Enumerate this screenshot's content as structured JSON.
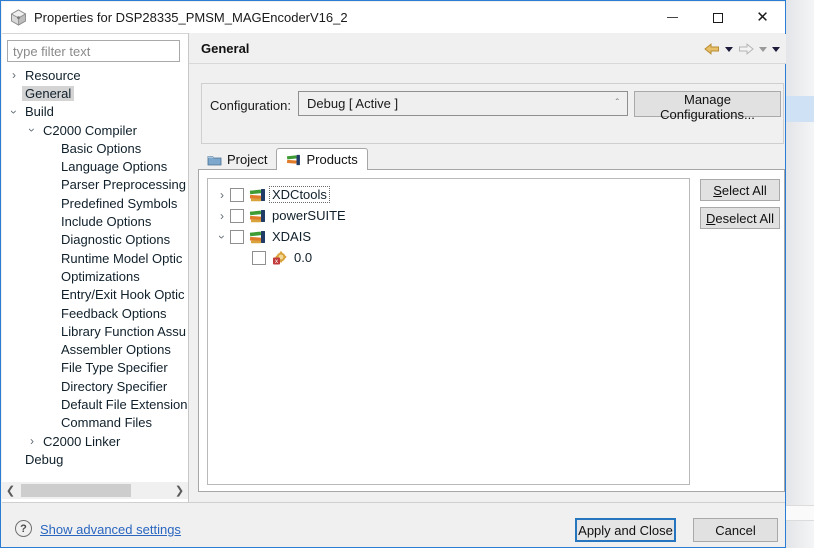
{
  "window": {
    "title": "Properties for DSP28335_PMSM_MAGEncoderV16_2",
    "controls": {
      "minimize": "minimize",
      "maximize": "maximize",
      "close": "close"
    }
  },
  "colors": {
    "accent_border": "#2b7cd3",
    "link": "#2a66c0",
    "selection_bg": "#d4d4d4",
    "background_band_blue": "#cfe2f5"
  },
  "sidebar": {
    "filter_placeholder": "type filter text",
    "items": [
      {
        "label": "Resource",
        "level": 0,
        "expander": "collapsed",
        "selected": false
      },
      {
        "label": "General",
        "level": 0,
        "expander": "none",
        "selected": true
      },
      {
        "label": "Build",
        "level": 0,
        "expander": "expanded",
        "selected": false
      },
      {
        "label": "C2000 Compiler",
        "level": 1,
        "expander": "expanded",
        "selected": false
      },
      {
        "label": "Basic Options",
        "level": 2,
        "expander": "none",
        "selected": false
      },
      {
        "label": "Language Options",
        "level": 2,
        "expander": "none",
        "selected": false
      },
      {
        "label": "Parser Preprocessing",
        "level": 2,
        "expander": "none",
        "selected": false
      },
      {
        "label": "Predefined Symbols",
        "level": 2,
        "expander": "none",
        "selected": false
      },
      {
        "label": "Include Options",
        "level": 2,
        "expander": "none",
        "selected": false
      },
      {
        "label": "Diagnostic Options",
        "level": 2,
        "expander": "none",
        "selected": false
      },
      {
        "label": "Runtime Model Optic",
        "level": 2,
        "expander": "none",
        "selected": false
      },
      {
        "label": "Optimizations",
        "level": 2,
        "expander": "none",
        "selected": false
      },
      {
        "label": "Entry/Exit Hook Optic",
        "level": 2,
        "expander": "none",
        "selected": false
      },
      {
        "label": "Feedback Options",
        "level": 2,
        "expander": "none",
        "selected": false
      },
      {
        "label": "Library Function Assu",
        "level": 2,
        "expander": "none",
        "selected": false
      },
      {
        "label": "Assembler Options",
        "level": 2,
        "expander": "none",
        "selected": false
      },
      {
        "label": "File Type Specifier",
        "level": 2,
        "expander": "none",
        "selected": false
      },
      {
        "label": "Directory Specifier",
        "level": 2,
        "expander": "none",
        "selected": false
      },
      {
        "label": "Default File Extension",
        "level": 2,
        "expander": "none",
        "selected": false
      },
      {
        "label": "Command Files",
        "level": 2,
        "expander": "none",
        "selected": false
      },
      {
        "label": "C2000 Linker",
        "level": 1,
        "expander": "collapsed",
        "selected": false
      },
      {
        "label": "Debug",
        "level": 0,
        "expander": "none",
        "selected": false
      }
    ]
  },
  "header": {
    "title": "General"
  },
  "config": {
    "label": "Configuration:",
    "value": "Debug  [ Active ]",
    "manage_button": "Manage Configurations..."
  },
  "tabs": [
    {
      "label": "Project",
      "icon": "folder-icon",
      "active": false
    },
    {
      "label": "Products",
      "icon": "products-icon",
      "active": true
    }
  ],
  "products_tree": {
    "items": [
      {
        "label": "XDCtools",
        "level": 0,
        "expander": "collapsed",
        "checked": false,
        "focused": true,
        "icon": "package-stack-icon"
      },
      {
        "label": "powerSUITE",
        "level": 0,
        "expander": "collapsed",
        "checked": false,
        "focused": false,
        "icon": "package-stack-icon"
      },
      {
        "label": "XDAIS",
        "level": 0,
        "expander": "expanded",
        "checked": false,
        "focused": false,
        "icon": "package-stack-icon"
      },
      {
        "label": "0.0",
        "level": 1,
        "expander": "none",
        "checked": false,
        "focused": false,
        "icon": "package-error-icon"
      }
    ]
  },
  "actions": {
    "select_all": "Select All",
    "deselect_all": "Deselect All"
  },
  "footer": {
    "help_glyph": "?",
    "link": "Show advanced settings",
    "apply_button": "Apply and Close",
    "cancel_button": "Cancel"
  }
}
